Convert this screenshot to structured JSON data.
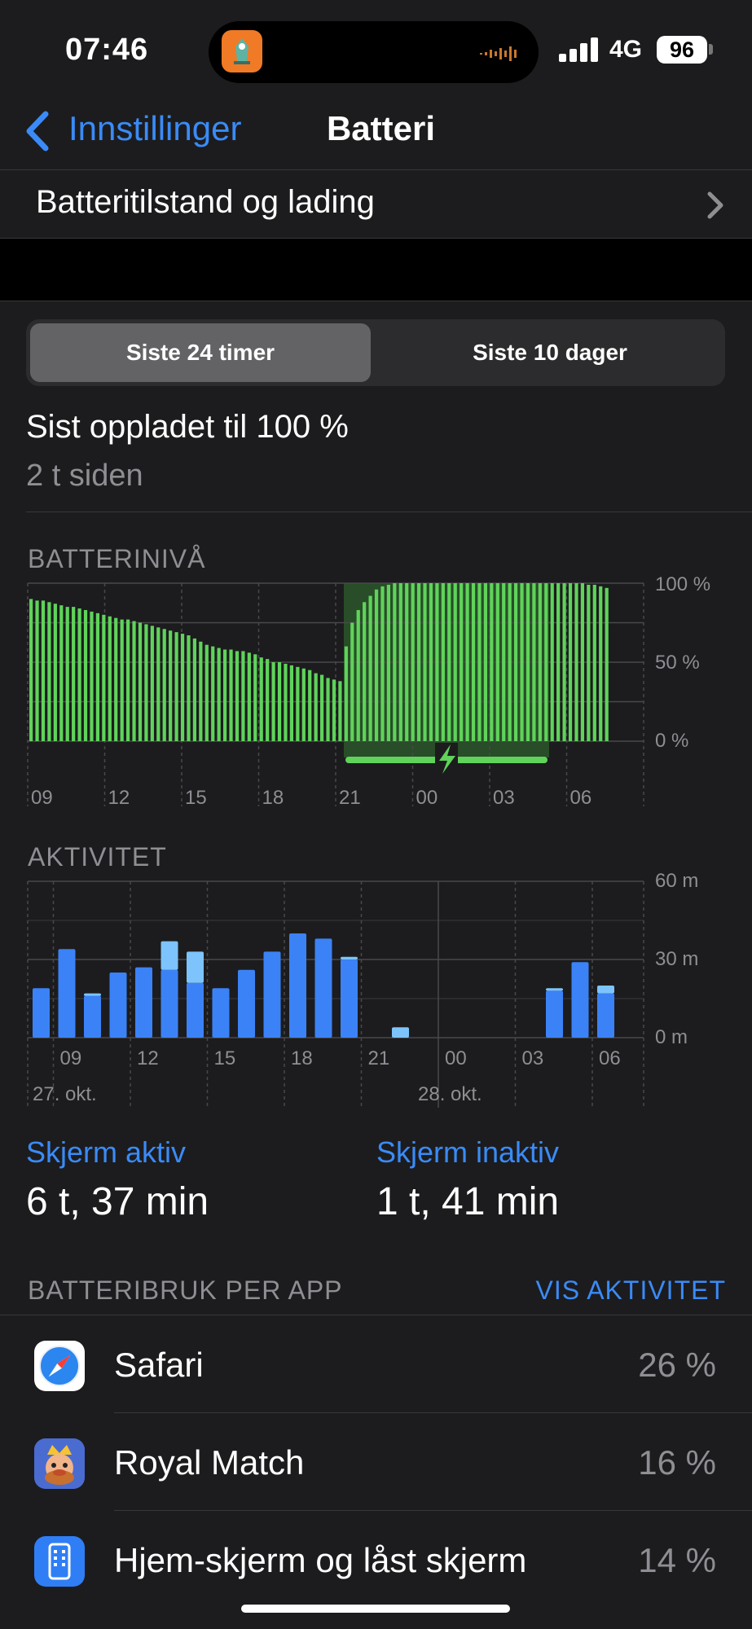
{
  "status_bar": {
    "time": "07:46",
    "network": "4G",
    "battery_level": "96",
    "island_app_icon": "live-activity-app-icon"
  },
  "nav": {
    "back_label": "Innstillinger",
    "title": "Batteri"
  },
  "health_row": {
    "label": "Batteritilstand og lading"
  },
  "segmented": {
    "tabs": [
      "Siste 24 timer",
      "Siste 10 dager"
    ],
    "selected": 0
  },
  "last_charged": {
    "title": "Sist opp­ladet til 100 %",
    "subtitle": "2 t siden"
  },
  "battery_chart": {
    "section_title": "BATTERINIVÅ",
    "y_ticks": [
      "100 %",
      "50 %",
      "0 %"
    ],
    "x_ticks": [
      "09",
      "12",
      "15",
      "18",
      "21",
      "00",
      "03",
      "06"
    ]
  },
  "activity_chart": {
    "section_title": "AKTIVITET",
    "y_ticks": [
      "60 m",
      "30 m",
      "0 m"
    ],
    "x_ticks": [
      "09",
      "12",
      "15",
      "18",
      "21",
      "00",
      "03",
      "06"
    ],
    "date_labels": [
      "27. okt.",
      "28. okt."
    ]
  },
  "metrics": [
    {
      "label": "Skjerm aktiv",
      "value": "6 t, 37 min"
    },
    {
      "label": "Skjerm inaktiv",
      "value": "1 t, 41 min"
    }
  ],
  "usage": {
    "section_title": "BATTERIBRUK PER APP",
    "action_label": "VIS AKTIVITET",
    "apps": [
      {
        "name": "Safari",
        "percent": "26 %",
        "icon": "safari-icon"
      },
      {
        "name": "Royal Match",
        "percent": "16 %",
        "icon": "royal-match-icon"
      },
      {
        "name": "Hjem-skjerm og låst skjerm",
        "percent": "14 %",
        "icon": "home-lock-screen-icon"
      }
    ]
  },
  "colors": {
    "accent": "#3a8bf7",
    "battery_bar": "#5fd35a",
    "activity_dark": "#3b82f6",
    "activity_light": "#7cc4fb"
  },
  "chart_data": [
    {
      "type": "bar",
      "title": "BATTERINIVÅ",
      "xlabel": "",
      "ylabel": "",
      "ylim": [
        0,
        100
      ],
      "x_tick_labels": [
        "09",
        "12",
        "15",
        "18",
        "21",
        "00",
        "03",
        "06"
      ],
      "charging_interval_hours": [
        21.0,
        5.0
      ],
      "series": [
        {
          "values": [
            90,
            89,
            89,
            88,
            87,
            86,
            85,
            85,
            84,
            83,
            82,
            81,
            80,
            79,
            78,
            77,
            77,
            76,
            75,
            74,
            73,
            72,
            71,
            70,
            69,
            68,
            67,
            65,
            63,
            61,
            60,
            59,
            58,
            58,
            57,
            57,
            56,
            55,
            53,
            52,
            50,
            50,
            49,
            48,
            47,
            46,
            45,
            43,
            42,
            40,
            39,
            38,
            60,
            75,
            83,
            88,
            92,
            96,
            98,
            99,
            100,
            100,
            100,
            100,
            100,
            100,
            100,
            100,
            100,
            100,
            100,
            100,
            100,
            100,
            100,
            100,
            100,
            100,
            100,
            100,
            100,
            100,
            100,
            100,
            100,
            100,
            100,
            100,
            100,
            100,
            100,
            100,
            99,
            99,
            98,
            97
          ]
        }
      ]
    },
    {
      "type": "bar",
      "title": "AKTIVITET",
      "xlabel": "",
      "ylabel": "",
      "ylim": [
        0,
        60
      ],
      "categories": [
        "08",
        "09",
        "10",
        "11",
        "12",
        "13",
        "14",
        "15",
        "16",
        "17",
        "18",
        "19",
        "20",
        "21",
        "22",
        "23",
        "00",
        "01",
        "02",
        "03",
        "04",
        "05",
        "06"
      ],
      "series": [
        {
          "name": "Skjerm aktiv",
          "values": [
            19,
            34,
            16,
            25,
            27,
            26,
            21,
            19,
            26,
            33,
            40,
            38,
            30,
            0,
            0,
            0,
            0,
            0,
            0,
            0,
            18,
            29,
            17
          ]
        },
        {
          "name": "Skjerm inaktiv",
          "values": [
            0,
            0,
            1,
            0,
            0,
            11,
            12,
            0,
            0,
            0,
            0,
            0,
            1,
            0,
            4,
            0,
            0,
            0,
            0,
            0,
            1,
            0,
            3
          ]
        }
      ]
    }
  ]
}
